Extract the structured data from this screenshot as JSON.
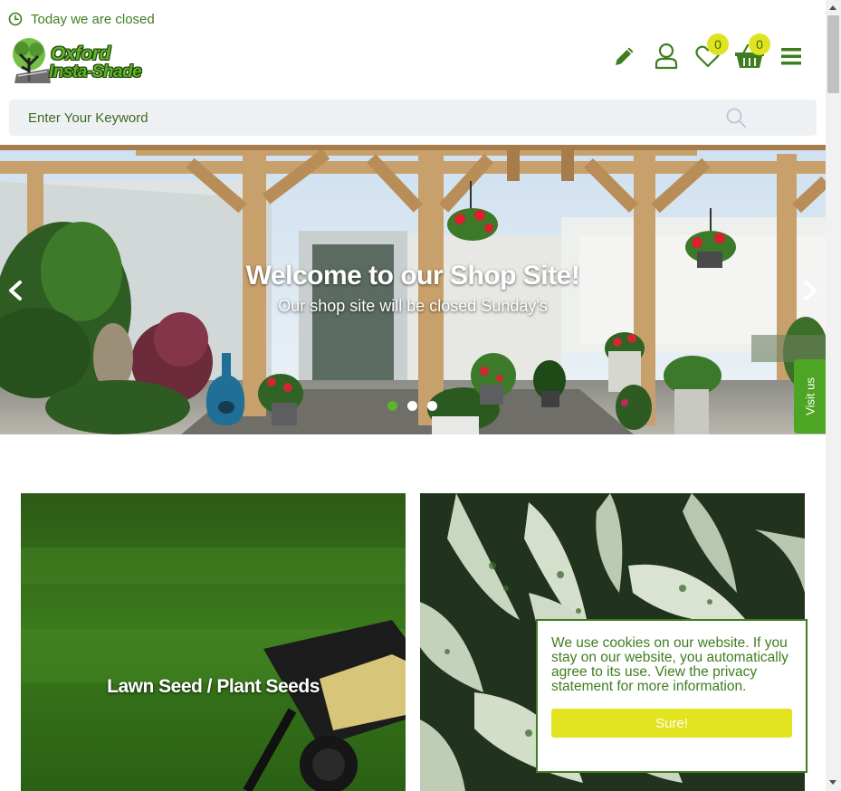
{
  "header": {
    "status_text": "Today we are closed",
    "logo": {
      "line1": "Oxford",
      "line2": "Insta-Shade"
    },
    "wishlist_count": "0",
    "cart_count": "0"
  },
  "search": {
    "placeholder": "Enter Your Keyword",
    "value": ""
  },
  "hero": {
    "title": "Welcome to our Shop Site!",
    "subtitle": "Our shop site will be closed Sunday's",
    "slide_count": 3,
    "active_slide": 1
  },
  "side_tab": {
    "label": "Visit us"
  },
  "categories": [
    {
      "label": "Lawn Seed / Plant Seeds"
    },
    {
      "label": ""
    }
  ],
  "cookie_notice": {
    "message": "We use cookies on our website. If you stay on our website, you automatically agree to its use. View the privacy statement for more information.",
    "button_label": "Sure!"
  },
  "colors": {
    "brand_green": "#3f7d20",
    "accent_green": "#5db426",
    "badge_yellow": "#dfe41e",
    "search_bg": "#eef1f4"
  },
  "icons": [
    "clock-icon",
    "pencil-icon",
    "user-icon",
    "heart-icon",
    "basket-icon",
    "menu-icon",
    "search-icon",
    "chevron-left-icon",
    "chevron-right-icon"
  ]
}
